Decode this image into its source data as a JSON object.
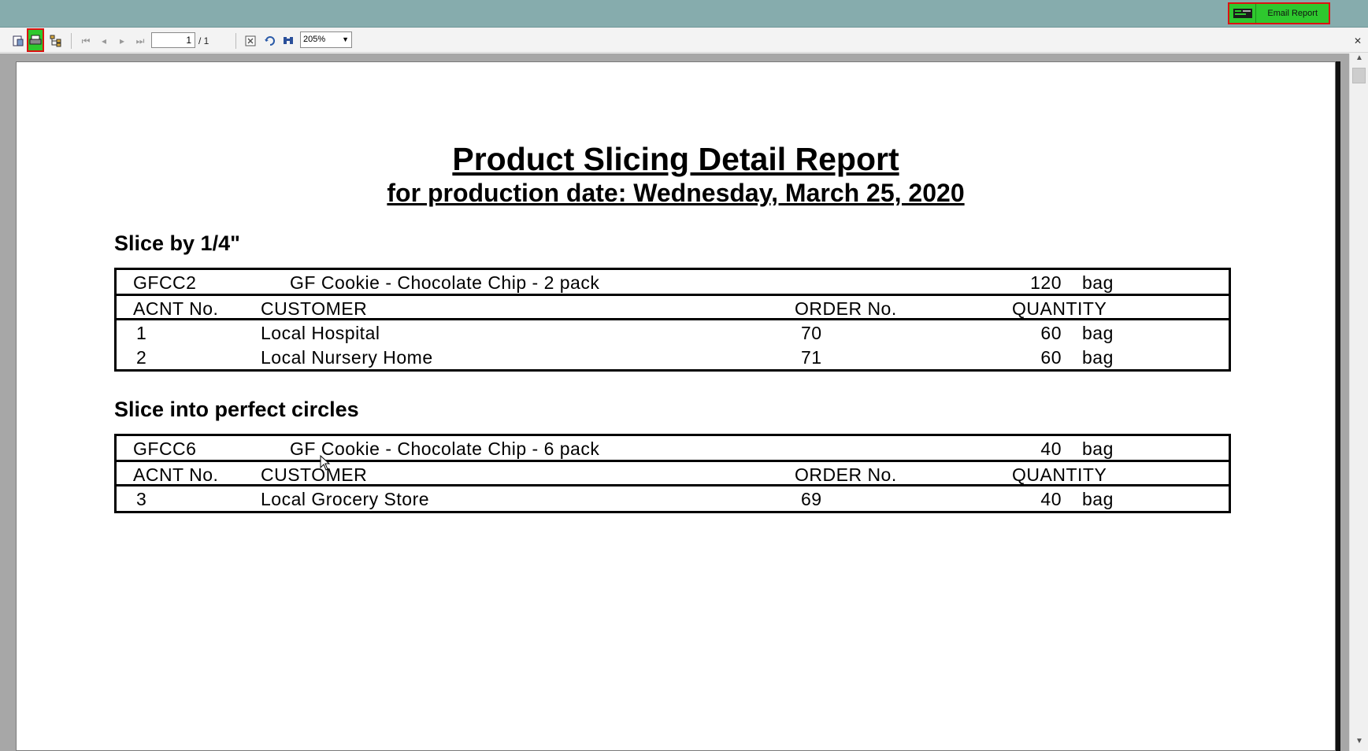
{
  "email_report": {
    "label": "Email Report",
    "icon": "email-report-icon"
  },
  "toolbar": {
    "page_current": "1",
    "page_total": "/ 1",
    "zoom": "205%",
    "icons": [
      "export-icon",
      "print-icon",
      "group-tree-icon",
      "first-page-icon",
      "prev-page-icon",
      "next-page-icon",
      "last-page-icon",
      "stop-icon",
      "refresh-icon",
      "search-icon",
      "close-icon"
    ]
  },
  "report": {
    "title": "Product Slicing Detail Report",
    "subtitle": "for production date: Wednesday, March 25, 2020",
    "headers": {
      "acnt": "ACNT No.",
      "customer": "CUSTOMER",
      "order": "ORDER No.",
      "quantity": "QUANTITY"
    },
    "sections": [
      {
        "name": "Slice by 1/4\"",
        "product_code": "GFCC2",
        "product_desc": "GF Cookie - Chocolate Chip - 2 pack",
        "total_qty": "120",
        "total_unit": "bag",
        "rows": [
          {
            "acnt": "1",
            "customer": "Local Hospital",
            "order": "70",
            "qty": "60",
            "unit": "bag"
          },
          {
            "acnt": "2",
            "customer": "Local Nursery Home",
            "order": "71",
            "qty": "60",
            "unit": "bag"
          }
        ]
      },
      {
        "name": "Slice into perfect circles",
        "product_code": "GFCC6",
        "product_desc": "GF Cookie - Chocolate Chip - 6 pack",
        "total_qty": "40",
        "total_unit": "bag",
        "rows": [
          {
            "acnt": "3",
            "customer": "Local Grocery Store",
            "order": "69",
            "qty": "40",
            "unit": "bag"
          }
        ]
      }
    ]
  }
}
